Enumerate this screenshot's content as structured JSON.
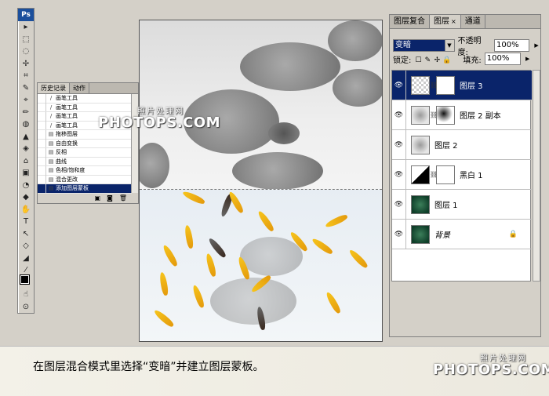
{
  "tools_palette": {
    "logo": "Ps",
    "tool_glyphs": [
      "▸",
      "⬚",
      "◌",
      "✢",
      "⌗",
      "✎",
      "⌖",
      "✏",
      "◍",
      "▲",
      "◈",
      "⌂",
      "▣",
      "◔",
      "◆",
      "✋",
      "T",
      "↖",
      "◇",
      "◢",
      "⁄",
      "⊕",
      "☝",
      "⊙"
    ]
  },
  "history_panel": {
    "tabs": [
      "历史记录",
      "动作"
    ],
    "items": [
      {
        "label": "画笔工具",
        "icon": "brush-icon"
      },
      {
        "label": "画笔工具",
        "icon": "brush-icon"
      },
      {
        "label": "画笔工具",
        "icon": "brush-icon"
      },
      {
        "label": "画笔工具",
        "icon": "brush-icon"
      },
      {
        "label": "拖移图层",
        "icon": "step-icon"
      },
      {
        "label": "自由变换",
        "icon": "step-icon"
      },
      {
        "label": "反相",
        "icon": "step-icon"
      },
      {
        "label": "曲线",
        "icon": "step-icon"
      },
      {
        "label": "色相/饱和度",
        "icon": "step-icon"
      },
      {
        "label": "混合更改",
        "icon": "step-icon"
      },
      {
        "label": "添加图层蒙板",
        "icon": "step-icon",
        "selected": true
      }
    ]
  },
  "watermark": {
    "chinese": "照片处理网",
    "english": "PHOTOPS.COM"
  },
  "layers_panel": {
    "tabs": [
      {
        "label": "图层复合",
        "active": false
      },
      {
        "label": "图层",
        "active": true,
        "close": "×"
      },
      {
        "label": "通道",
        "active": false
      }
    ],
    "blend_mode": "变暗",
    "opacity_label": "不透明度:",
    "opacity_value": "100%",
    "lock_label": "锁定:",
    "fill_label": "填充:",
    "fill_value": "100%",
    "layers": [
      {
        "name": "图层 3",
        "thumb": "checker",
        "mask": "white",
        "selected": true
      },
      {
        "name": "图层 2 副本",
        "thumb": "gray",
        "mask": "ink",
        "selected": false
      },
      {
        "name": "图层 2",
        "thumb": "gray",
        "mask": "none",
        "selected": false
      },
      {
        "name": "黑白 1",
        "thumb": "bw",
        "mask": "white",
        "selected": false
      },
      {
        "name": "图层 1",
        "thumb": "green",
        "mask": "none",
        "selected": false
      },
      {
        "name": "背景",
        "thumb": "green",
        "mask": "none",
        "selected": false,
        "locked": true
      }
    ]
  },
  "caption": {
    "text": "在图层混合模式里选择“变暗”并建立图层蒙板。"
  },
  "colors": {
    "selection": "#0a246a",
    "panel_bg": "#d4d0c8",
    "ps_blue": "#1b4f9c",
    "fish_gold": "#f6c41c"
  }
}
